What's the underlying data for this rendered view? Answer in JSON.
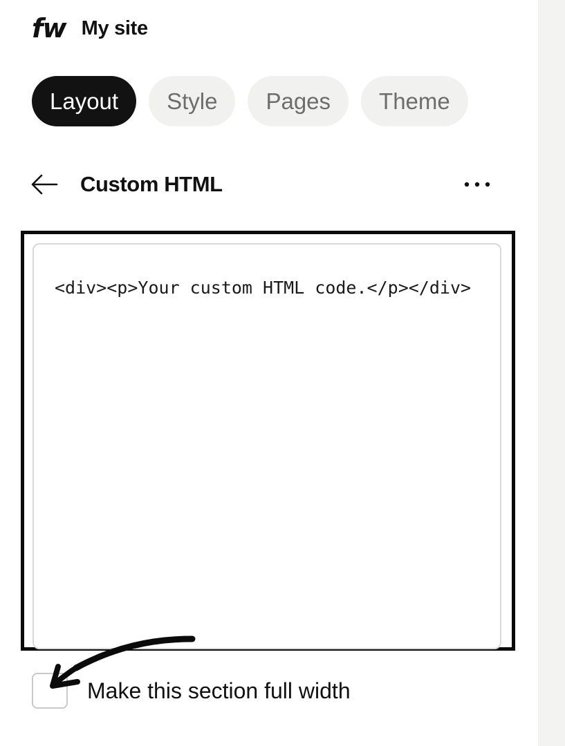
{
  "header": {
    "logo_text": "fw",
    "site_name": "My site"
  },
  "tabs": [
    {
      "label": "Layout",
      "active": true
    },
    {
      "label": "Style",
      "active": false
    },
    {
      "label": "Pages",
      "active": false
    },
    {
      "label": "Theme",
      "active": false
    }
  ],
  "section": {
    "title": "Custom HTML",
    "back_icon": "arrow-left-icon",
    "more_icon": "more-horizontal-icon"
  },
  "editor": {
    "value": "<div><p>Your custom HTML code.</p></div>"
  },
  "full_width_option": {
    "label": "Make this section full width",
    "checked": false
  },
  "colors": {
    "active_tab_bg": "#121212",
    "inactive_tab_bg": "#f1f1f0",
    "highlight_border": "#0b0b0b",
    "right_panel_bg": "#f3f3f2"
  }
}
